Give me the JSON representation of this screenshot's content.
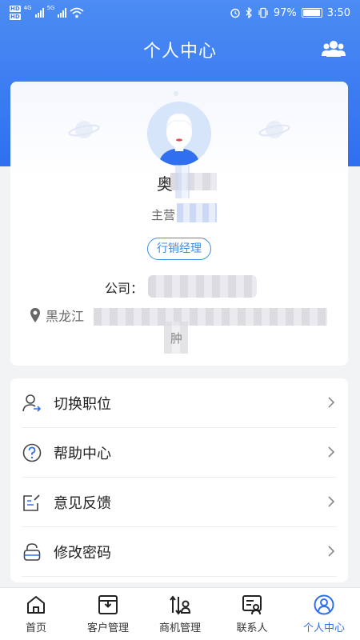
{
  "status_bar": {
    "hd_label": "HD",
    "network_4g": "4G",
    "network_5g": "5G",
    "battery_pct": "97%",
    "battery_level": 0.97,
    "time": "3:50"
  },
  "header": {
    "title": "个人中心",
    "group_icon": "group-icon"
  },
  "profile": {
    "name_visible": "奥",
    "role_visible": "主营",
    "tag": "行销经理",
    "company_label": "公司：",
    "address_visible": "黑龙江",
    "address_tail": "肿"
  },
  "menu": {
    "items": [
      {
        "label": "切换职位",
        "icon": "switch-position-icon"
      },
      {
        "label": "帮助中心",
        "icon": "help-icon"
      },
      {
        "label": "意见反馈",
        "icon": "feedback-icon"
      },
      {
        "label": "修改密码",
        "icon": "lock-icon"
      }
    ]
  },
  "tabs": [
    {
      "label": "首页",
      "icon": "home-icon",
      "active": false
    },
    {
      "label": "客户管理",
      "icon": "customer-icon",
      "active": false
    },
    {
      "label": "商机管理",
      "icon": "opportunity-icon",
      "active": false
    },
    {
      "label": "联系人",
      "icon": "contacts-icon",
      "active": false
    },
    {
      "label": "个人中心",
      "icon": "profile-icon",
      "active": true
    }
  ],
  "colors": {
    "brand": "#2f6ff0",
    "accent_tag": "#3b8ee5"
  }
}
